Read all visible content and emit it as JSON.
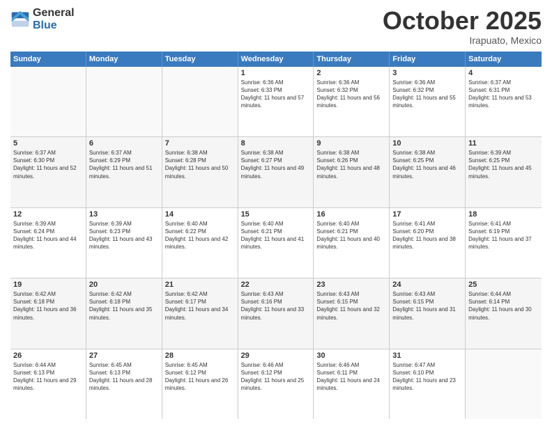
{
  "header": {
    "logo_general": "General",
    "logo_blue": "Blue",
    "month_title": "October 2025",
    "subtitle": "Irapuato, Mexico"
  },
  "days_of_week": [
    "Sunday",
    "Monday",
    "Tuesday",
    "Wednesday",
    "Thursday",
    "Friday",
    "Saturday"
  ],
  "weeks": [
    [
      {
        "day": "",
        "sunrise": "",
        "sunset": "",
        "daylight": "",
        "empty": true
      },
      {
        "day": "",
        "sunrise": "",
        "sunset": "",
        "daylight": "",
        "empty": true
      },
      {
        "day": "",
        "sunrise": "",
        "sunset": "",
        "daylight": "",
        "empty": true
      },
      {
        "day": "1",
        "sunrise": "Sunrise: 6:36 AM",
        "sunset": "Sunset: 6:33 PM",
        "daylight": "Daylight: 11 hours and 57 minutes.",
        "empty": false
      },
      {
        "day": "2",
        "sunrise": "Sunrise: 6:36 AM",
        "sunset": "Sunset: 6:32 PM",
        "daylight": "Daylight: 11 hours and 56 minutes.",
        "empty": false
      },
      {
        "day": "3",
        "sunrise": "Sunrise: 6:36 AM",
        "sunset": "Sunset: 6:32 PM",
        "daylight": "Daylight: 11 hours and 55 minutes.",
        "empty": false
      },
      {
        "day": "4",
        "sunrise": "Sunrise: 6:37 AM",
        "sunset": "Sunset: 6:31 PM",
        "daylight": "Daylight: 11 hours and 53 minutes.",
        "empty": false
      }
    ],
    [
      {
        "day": "5",
        "sunrise": "Sunrise: 6:37 AM",
        "sunset": "Sunset: 6:30 PM",
        "daylight": "Daylight: 11 hours and 52 minutes.",
        "empty": false
      },
      {
        "day": "6",
        "sunrise": "Sunrise: 6:37 AM",
        "sunset": "Sunset: 6:29 PM",
        "daylight": "Daylight: 11 hours and 51 minutes.",
        "empty": false
      },
      {
        "day": "7",
        "sunrise": "Sunrise: 6:38 AM",
        "sunset": "Sunset: 6:28 PM",
        "daylight": "Daylight: 11 hours and 50 minutes.",
        "empty": false
      },
      {
        "day": "8",
        "sunrise": "Sunrise: 6:38 AM",
        "sunset": "Sunset: 6:27 PM",
        "daylight": "Daylight: 11 hours and 49 minutes.",
        "empty": false
      },
      {
        "day": "9",
        "sunrise": "Sunrise: 6:38 AM",
        "sunset": "Sunset: 6:26 PM",
        "daylight": "Daylight: 11 hours and 48 minutes.",
        "empty": false
      },
      {
        "day": "10",
        "sunrise": "Sunrise: 6:38 AM",
        "sunset": "Sunset: 6:25 PM",
        "daylight": "Daylight: 11 hours and 46 minutes.",
        "empty": false
      },
      {
        "day": "11",
        "sunrise": "Sunrise: 6:39 AM",
        "sunset": "Sunset: 6:25 PM",
        "daylight": "Daylight: 11 hours and 45 minutes.",
        "empty": false
      }
    ],
    [
      {
        "day": "12",
        "sunrise": "Sunrise: 6:39 AM",
        "sunset": "Sunset: 6:24 PM",
        "daylight": "Daylight: 11 hours and 44 minutes.",
        "empty": false
      },
      {
        "day": "13",
        "sunrise": "Sunrise: 6:39 AM",
        "sunset": "Sunset: 6:23 PM",
        "daylight": "Daylight: 11 hours and 43 minutes.",
        "empty": false
      },
      {
        "day": "14",
        "sunrise": "Sunrise: 6:40 AM",
        "sunset": "Sunset: 6:22 PM",
        "daylight": "Daylight: 11 hours and 42 minutes.",
        "empty": false
      },
      {
        "day": "15",
        "sunrise": "Sunrise: 6:40 AM",
        "sunset": "Sunset: 6:21 PM",
        "daylight": "Daylight: 11 hours and 41 minutes.",
        "empty": false
      },
      {
        "day": "16",
        "sunrise": "Sunrise: 6:40 AM",
        "sunset": "Sunset: 6:21 PM",
        "daylight": "Daylight: 11 hours and 40 minutes.",
        "empty": false
      },
      {
        "day": "17",
        "sunrise": "Sunrise: 6:41 AM",
        "sunset": "Sunset: 6:20 PM",
        "daylight": "Daylight: 11 hours and 38 minutes.",
        "empty": false
      },
      {
        "day": "18",
        "sunrise": "Sunrise: 6:41 AM",
        "sunset": "Sunset: 6:19 PM",
        "daylight": "Daylight: 11 hours and 37 minutes.",
        "empty": false
      }
    ],
    [
      {
        "day": "19",
        "sunrise": "Sunrise: 6:42 AM",
        "sunset": "Sunset: 6:18 PM",
        "daylight": "Daylight: 11 hours and 36 minutes.",
        "empty": false
      },
      {
        "day": "20",
        "sunrise": "Sunrise: 6:42 AM",
        "sunset": "Sunset: 6:18 PM",
        "daylight": "Daylight: 11 hours and 35 minutes.",
        "empty": false
      },
      {
        "day": "21",
        "sunrise": "Sunrise: 6:42 AM",
        "sunset": "Sunset: 6:17 PM",
        "daylight": "Daylight: 11 hours and 34 minutes.",
        "empty": false
      },
      {
        "day": "22",
        "sunrise": "Sunrise: 6:43 AM",
        "sunset": "Sunset: 6:16 PM",
        "daylight": "Daylight: 11 hours and 33 minutes.",
        "empty": false
      },
      {
        "day": "23",
        "sunrise": "Sunrise: 6:43 AM",
        "sunset": "Sunset: 6:15 PM",
        "daylight": "Daylight: 11 hours and 32 minutes.",
        "empty": false
      },
      {
        "day": "24",
        "sunrise": "Sunrise: 6:43 AM",
        "sunset": "Sunset: 6:15 PM",
        "daylight": "Daylight: 11 hours and 31 minutes.",
        "empty": false
      },
      {
        "day": "25",
        "sunrise": "Sunrise: 6:44 AM",
        "sunset": "Sunset: 6:14 PM",
        "daylight": "Daylight: 11 hours and 30 minutes.",
        "empty": false
      }
    ],
    [
      {
        "day": "26",
        "sunrise": "Sunrise: 6:44 AM",
        "sunset": "Sunset: 6:13 PM",
        "daylight": "Daylight: 11 hours and 29 minutes.",
        "empty": false
      },
      {
        "day": "27",
        "sunrise": "Sunrise: 6:45 AM",
        "sunset": "Sunset: 6:13 PM",
        "daylight": "Daylight: 11 hours and 28 minutes.",
        "empty": false
      },
      {
        "day": "28",
        "sunrise": "Sunrise: 6:45 AM",
        "sunset": "Sunset: 6:12 PM",
        "daylight": "Daylight: 11 hours and 26 minutes.",
        "empty": false
      },
      {
        "day": "29",
        "sunrise": "Sunrise: 6:46 AM",
        "sunset": "Sunset: 6:12 PM",
        "daylight": "Daylight: 11 hours and 25 minutes.",
        "empty": false
      },
      {
        "day": "30",
        "sunrise": "Sunrise: 6:46 AM",
        "sunset": "Sunset: 6:11 PM",
        "daylight": "Daylight: 11 hours and 24 minutes.",
        "empty": false
      },
      {
        "day": "31",
        "sunrise": "Sunrise: 6:47 AM",
        "sunset": "Sunset: 6:10 PM",
        "daylight": "Daylight: 11 hours and 23 minutes.",
        "empty": false
      },
      {
        "day": "",
        "sunrise": "",
        "sunset": "",
        "daylight": "",
        "empty": true
      }
    ]
  ]
}
